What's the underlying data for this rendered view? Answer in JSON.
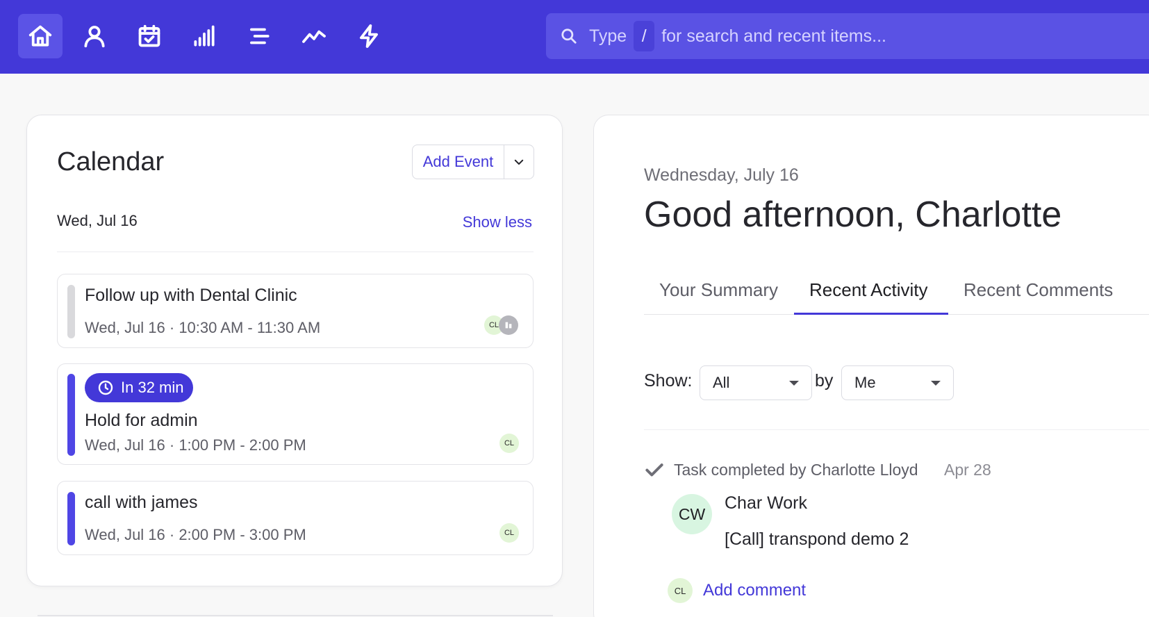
{
  "colors": {
    "brand": "#4338d8",
    "topbar_active": "#5b53e6",
    "event_gray": "#d9d9dc",
    "event_purple": "#4f46e5"
  },
  "nav": {
    "items": [
      {
        "name": "home-icon",
        "active": true
      },
      {
        "name": "person-icon",
        "active": false
      },
      {
        "name": "calendar-check-icon",
        "active": false
      },
      {
        "name": "bar-signal-icon",
        "active": false
      },
      {
        "name": "list-icon",
        "active": false
      },
      {
        "name": "activity-line-icon",
        "active": false
      },
      {
        "name": "lightning-icon",
        "active": false
      }
    ]
  },
  "search": {
    "prefix": "Type",
    "key": "/",
    "suffix": "for search and recent items..."
  },
  "calendar": {
    "title": "Calendar",
    "add_event_label": "Add Event",
    "date_label": "Wed, Jul 16",
    "show_less": "Show less",
    "events": [
      {
        "title": "Follow up with Dental Clinic",
        "time": "Wed, Jul 16 · 10:30 AM - 11:30 AM",
        "avatar": "CL",
        "bar_color": "gray"
      },
      {
        "badge": "In 32 min",
        "title": "Hold for admin",
        "time": "Wed, Jul 16 · 1:00 PM - 2:00 PM",
        "avatar": "CL",
        "bar_color": "purple"
      },
      {
        "title": "call with james",
        "time": "Wed, Jul 16 · 2:00 PM - 3:00 PM",
        "avatar": "CL",
        "bar_color": "purple"
      }
    ]
  },
  "main": {
    "day": "Wednesday, July 16",
    "greeting": "Good afternoon, Charlotte",
    "tabs": [
      {
        "label": "Your Summary",
        "active": false
      },
      {
        "label": "Recent Activity",
        "active": true
      },
      {
        "label": "Recent Comments",
        "active": false
      }
    ],
    "filter": {
      "show_label": "Show:",
      "show_value": "All",
      "by_label": "by",
      "by_value": "Me"
    },
    "activity": {
      "text": "Task completed by Charlotte Lloyd",
      "date": "Apr 28",
      "avatar": "CW",
      "owner": "Char Work",
      "subject": "[Call] transpond demo 2",
      "comment_avatar": "CL",
      "add_comment": "Add comment"
    }
  }
}
